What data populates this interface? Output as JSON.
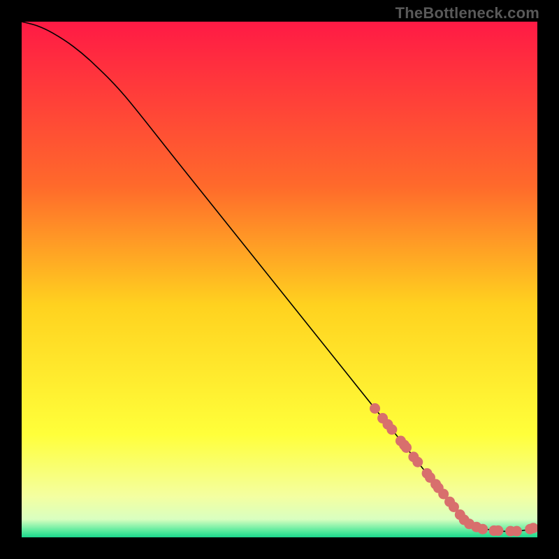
{
  "watermark": "TheBottleneck.com",
  "chart_data": {
    "type": "line",
    "title": "",
    "xlabel": "",
    "ylabel": "",
    "xlim": [
      0,
      100
    ],
    "ylim": [
      0,
      100
    ],
    "background_gradient": {
      "stops": [
        {
          "offset": 0.0,
          "color": "#ff1a45"
        },
        {
          "offset": 0.32,
          "color": "#ff6a2b"
        },
        {
          "offset": 0.55,
          "color": "#ffd21f"
        },
        {
          "offset": 0.8,
          "color": "#ffff3a"
        },
        {
          "offset": 0.92,
          "color": "#f4ffa0"
        },
        {
          "offset": 0.965,
          "color": "#d9ffc0"
        },
        {
          "offset": 0.99,
          "color": "#4be89a"
        },
        {
          "offset": 1.0,
          "color": "#1bd78d"
        }
      ]
    },
    "series": [
      {
        "name": "curve",
        "color": "#000000",
        "width": 1.6,
        "points_type": "curve",
        "x": [
          0,
          3,
          6,
          10,
          14,
          20,
          30,
          40,
          50,
          60,
          70,
          73,
          76,
          80,
          83,
          85,
          88,
          92,
          96,
          100
        ],
        "y": [
          100,
          99.2,
          97.8,
          95.2,
          91.8,
          85.6,
          73.1,
          60.6,
          48.1,
          35.6,
          23.1,
          19.4,
          15.6,
          10.6,
          6.9,
          4.4,
          2.2,
          1.3,
          1.2,
          1.8
        ]
      },
      {
        "name": "markers",
        "color": "#d86f6d",
        "width": 0,
        "points_type": "markers",
        "marker_radius": 7.5,
        "x": [
          68.5,
          70.0,
          71.0,
          71.8,
          73.5,
          74.2,
          74.6,
          76.0,
          76.8,
          78.6,
          79.2,
          80.3,
          80.8,
          81.8,
          83.0,
          83.8,
          85.0,
          85.8,
          86.8,
          88.2,
          89.4,
          91.6,
          92.4,
          94.8,
          96.0,
          98.6,
          99.2
        ],
        "y": [
          25.0,
          23.1,
          21.9,
          20.9,
          18.7,
          17.9,
          17.4,
          15.6,
          14.6,
          12.4,
          11.6,
          10.3,
          9.6,
          8.4,
          6.9,
          5.9,
          4.4,
          3.4,
          2.6,
          2.0,
          1.6,
          1.3,
          1.3,
          1.2,
          1.2,
          1.6,
          1.8
        ]
      }
    ]
  }
}
